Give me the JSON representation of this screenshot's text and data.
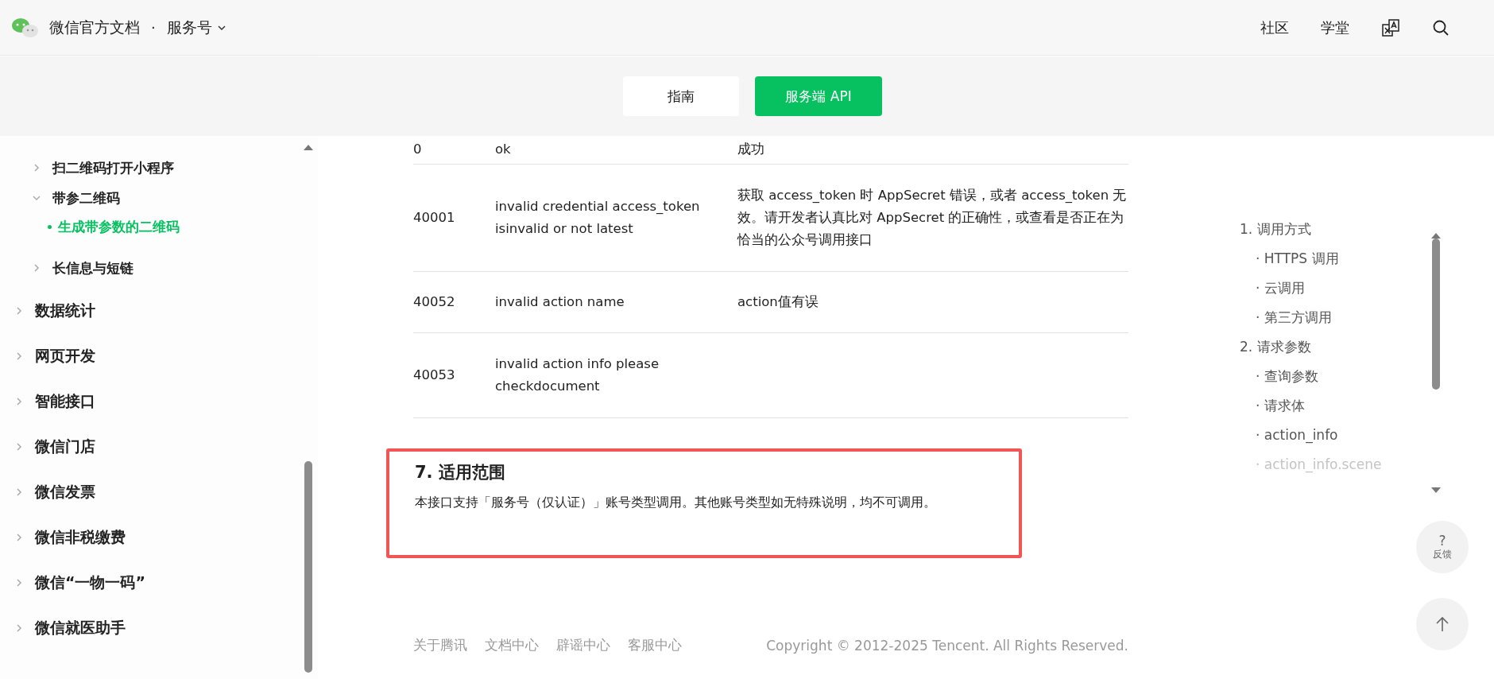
{
  "header": {
    "title": "微信官方文档",
    "separator": "·",
    "product": "服务号",
    "links": [
      "社区",
      "学堂"
    ]
  },
  "switcher": [
    {
      "label": "指南",
      "selected": false
    },
    {
      "label": "服务端 API",
      "selected": true
    }
  ],
  "sidebar": {
    "continued_children": [
      {
        "label": "扫二维码打开小程序",
        "expanded": false
      },
      {
        "label": "带参二维码",
        "expanded": true,
        "children": [
          {
            "label": "生成带参数的二维码",
            "selected": true
          }
        ]
      },
      {
        "label": "长信息与短链",
        "expanded": false
      }
    ],
    "items": [
      {
        "label": "数据统计",
        "expanded": false
      },
      {
        "label": "网页开发",
        "expanded": false
      },
      {
        "label": "智能接口",
        "expanded": false
      },
      {
        "label": "微信门店",
        "expanded": false
      },
      {
        "label": "微信发票",
        "expanded": false
      },
      {
        "label": "微信非税缴费",
        "expanded": false
      },
      {
        "label": "微信“一物一码”",
        "expanded": false
      },
      {
        "label": "微信就医助手",
        "expanded": false
      }
    ]
  },
  "table": {
    "rows": [
      [
        "0",
        "ok",
        "成功"
      ],
      [
        "40001",
        "invalid credential access_token isinvalid or not latest",
        "获取 access_token 时 AppSecret 错误，或者 access_token 无效。请开发者认真比对 AppSecret 的正确性，或查看是否正在为恰当的公众号调用接口"
      ],
      [
        "40052",
        "invalid action name",
        "action值有误"
      ],
      [
        "40053",
        "invalid action info  please checkdocument",
        ""
      ]
    ]
  },
  "section": {
    "title": "7. 适用范围",
    "text": "本接口支持「服务号（仅认证）」账号类型调用。其他账号类型如无特殊说明，均不可调用。",
    "highlighted": true
  },
  "footer": {
    "links": [
      "关于腾讯",
      "文档中心",
      "辟谣中心",
      "客服中心"
    ],
    "copyright": "Copyright © 2012-2025 Tencent. All Rights Reserved."
  },
  "toc": [
    {
      "label": "1. 调用方式",
      "children": [
        {
          "label": "· HTTPS 调用",
          "faded": false
        },
        {
          "label": "· 云调用",
          "faded": false
        },
        {
          "label": "· 第三方调用",
          "faded": false
        }
      ]
    },
    {
      "label": "2. 请求参数",
      "children": [
        {
          "label": "· 查询参数",
          "faded": false
        },
        {
          "label": "· 请求体",
          "faded": false
        },
        {
          "label": "· action_info",
          "faded": false
        },
        {
          "label": "· action_info.scene",
          "faded": true
        }
      ]
    }
  ],
  "feedback": {
    "symbol": "?",
    "label": "反馈"
  }
}
